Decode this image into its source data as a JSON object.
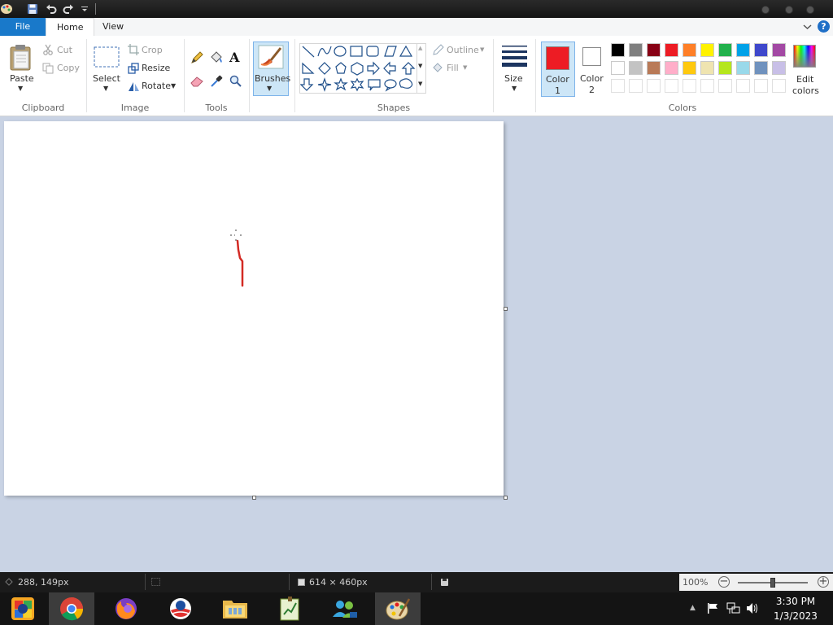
{
  "ribbon_tabs": {
    "file": "File",
    "home": "Home",
    "view": "View"
  },
  "clipboard": {
    "paste": "Paste",
    "cut": "Cut",
    "copy": "Copy",
    "label": "Clipboard"
  },
  "image": {
    "select": "Select",
    "crop": "Crop",
    "resize": "Resize",
    "rotate": "Rotate",
    "label": "Image"
  },
  "tools": {
    "label": "Tools"
  },
  "brushes": {
    "label": "Brushes"
  },
  "shapes": {
    "outline": "Outline",
    "fill": "Fill",
    "label": "Shapes"
  },
  "size": {
    "label": "Size"
  },
  "colors": {
    "color1_line1": "Color",
    "color1_line2": "1",
    "color2_line1": "Color",
    "color2_line2": "2",
    "edit_line1": "Edit",
    "edit_line2": "colors",
    "label": "Colors",
    "color1_value": "#ed1c24",
    "color2_value": "#ffffff",
    "palette_row1": [
      "#000000",
      "#7f7f7f",
      "#880015",
      "#ed1c24",
      "#ff7f27",
      "#fff200",
      "#22b14c",
      "#00a2e8",
      "#3f48cc",
      "#a349a4"
    ],
    "palette_row2": [
      "#ffffff",
      "#c3c3c3",
      "#b97a57",
      "#ffaec9",
      "#ffc90e",
      "#efe4b0",
      "#b5e61d",
      "#99d9ea",
      "#7092be",
      "#c8bfe7"
    ]
  },
  "status": {
    "cursor_pos": "288, 149px",
    "canvas_size": "614 × 460px",
    "zoom": "100%",
    "zoom_fraction": 0.5
  },
  "taskbar": {
    "time": "3:30 PM",
    "date": "1/3/2023"
  }
}
